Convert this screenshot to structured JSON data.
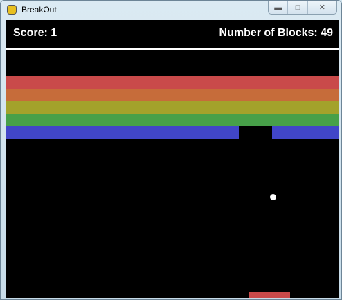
{
  "window": {
    "title": "BreakOut",
    "icon": "pygame-snake-icon",
    "controls": [
      "minimize-icon",
      "maximize-icon",
      "close-icon"
    ]
  },
  "hud": {
    "score_label": "Score: 1",
    "blocks_label": "Number of Blocks: 49"
  },
  "game": {
    "columns": 10,
    "rows": [
      {
        "color": "#c94a4a"
      },
      {
        "color": "#c66c3a"
      },
      {
        "color": "#a3a22b"
      },
      {
        "color": "#47a049"
      },
      {
        "color": "#4146c8"
      }
    ],
    "missing_bricks": [
      {
        "row": 4,
        "col": 7
      }
    ],
    "paddle_color": "#c94a4a",
    "ball_color": "#ffffff"
  }
}
